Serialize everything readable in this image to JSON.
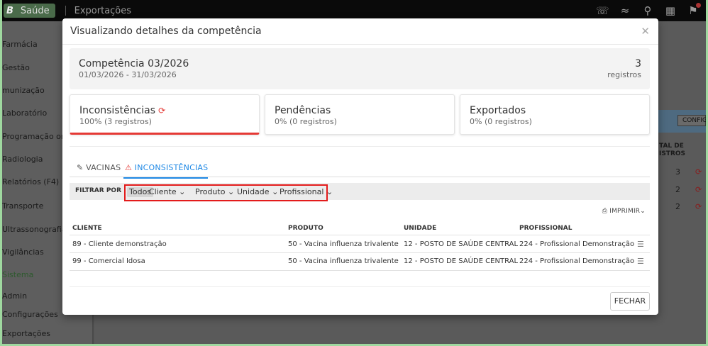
{
  "topbar": {
    "logo": "B",
    "app_name": "Saúde",
    "page_title": "Exportações",
    "icons": [
      "headset-icon",
      "wifi-icon",
      "search-icon",
      "grid-icon",
      "notifications-icon"
    ]
  },
  "sidebar": {
    "items": [
      "Farmácia",
      "Gestão",
      "munização",
      "Laboratório",
      "Programação orç",
      "Radiologia",
      "Relatórios (F4)",
      "Transporte",
      "Ultrassonografia",
      "Vigilâncias",
      "Sistema",
      "Admin",
      "Configurações",
      "Exportações"
    ]
  },
  "background": {
    "config_button": "CONFIG",
    "total_header_line1": "TAL DE",
    "total_header_line2": "ISTROS",
    "totals": [
      "3",
      "2",
      "2"
    ]
  },
  "modal": {
    "title": "Visualizando detalhes da competência",
    "close_symbol": "✕",
    "competencia": {
      "title": "Competência 03/2026",
      "range": "01/03/2026 - 31/03/2026",
      "count": "3",
      "count_label": "registros"
    },
    "cards": [
      {
        "title": "Inconsistências",
        "sub": "100% (3 registros)"
      },
      {
        "title": "Pendências",
        "sub": "0% (0 registros)"
      },
      {
        "title": "Exportados",
        "sub": "0% (0 registros)"
      }
    ],
    "tabs": {
      "vacinas": "VACINAS",
      "inconsistencias": "INCONSISTÊNCIAS"
    },
    "filter": {
      "label": "FILTRAR POR",
      "options": [
        "Todos",
        "Cliente",
        "Produto",
        "Unidade",
        "Profissional"
      ]
    },
    "print_label": "IMPRIMIR",
    "table": {
      "headers": [
        "CLIENTE",
        "PRODUTO",
        "UNIDADE",
        "PROFISSIONAL"
      ],
      "rows": [
        [
          "89 - Cliente demonstração",
          "50 - Vacina influenza trivalente",
          "12 - POSTO DE SAÚDE CENTRAL",
          "224 - Profissional Demonstração"
        ],
        [
          "99 - Comercial Idosa",
          "50 - Vacina influenza trivalente",
          "12 - POSTO DE SAÚDE CENTRAL",
          "224 - Profissional Demonstração"
        ]
      ]
    },
    "close_button": "FECHAR"
  },
  "colors": {
    "accent_blue": "#1e88e5",
    "alert_red": "#e53935",
    "highlight_box": "#e31b1b"
  }
}
